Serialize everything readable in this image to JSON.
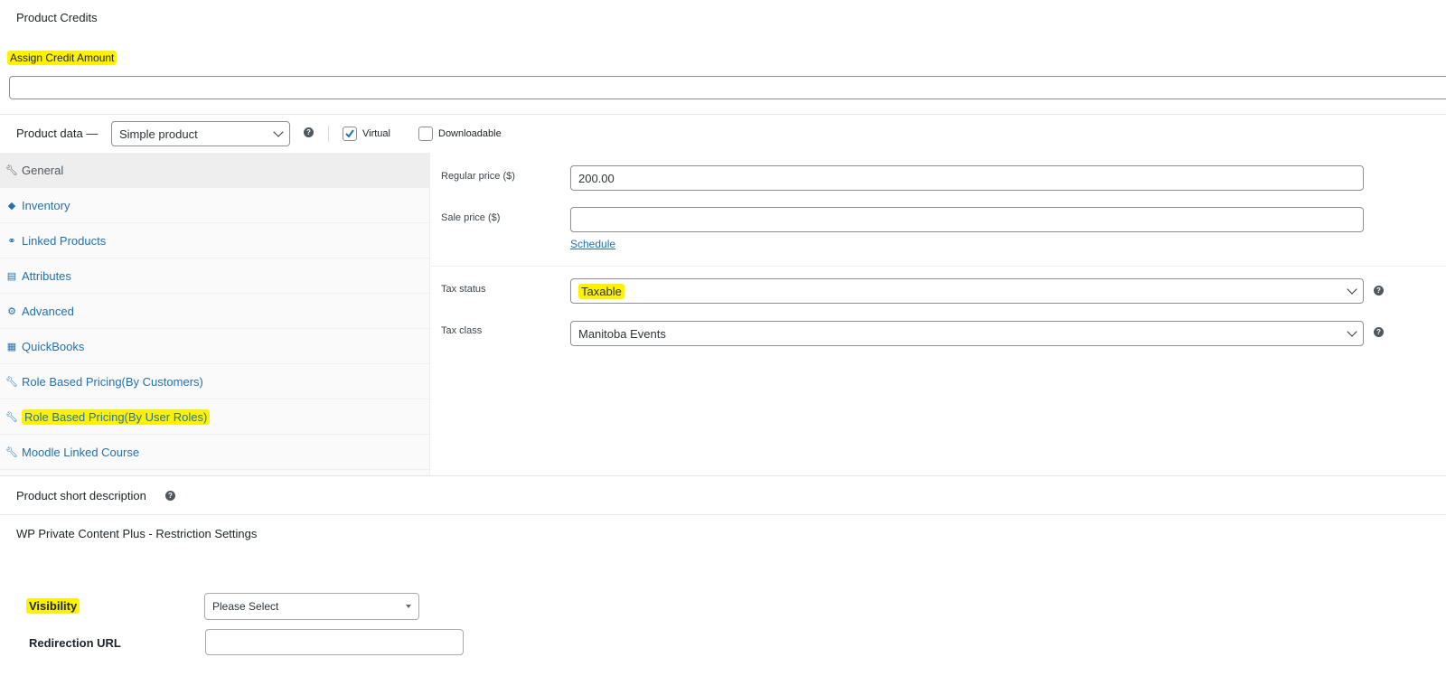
{
  "credits": {
    "section_title": "Product Credits",
    "assign_label": "Assign Credit Amount",
    "assign_value": ""
  },
  "product_data": {
    "label": "Product data —",
    "type_selected": "Simple product",
    "virtual_label": "Virtual",
    "virtual_checked": true,
    "downloadable_label": "Downloadable",
    "downloadable_checked": false
  },
  "tabs": [
    {
      "label": "General",
      "icon": "wrench-icon"
    },
    {
      "label": "Inventory",
      "icon": "tag-icon"
    },
    {
      "label": "Linked Products",
      "icon": "link-icon"
    },
    {
      "label": "Attributes",
      "icon": "list-icon"
    },
    {
      "label": "Advanced",
      "icon": "gear-icon"
    },
    {
      "label": "QuickBooks",
      "icon": "table-icon"
    },
    {
      "label": "Role Based Pricing(By Customers)",
      "icon": "wrench-icon"
    },
    {
      "label": "Role Based Pricing(By User Roles)",
      "icon": "wrench-icon"
    },
    {
      "label": "Moodle Linked Course",
      "icon": "wrench-icon"
    }
  ],
  "general": {
    "regular_price_label": "Regular price ($)",
    "regular_price_value": "200.00",
    "sale_price_label": "Sale price ($)",
    "sale_price_value": "",
    "schedule_link": "Schedule",
    "tax_status_label": "Tax status",
    "tax_status_value": "Taxable",
    "tax_class_label": "Tax class",
    "tax_class_value": "Manitoba Events"
  },
  "short_description": {
    "title": "Product short description"
  },
  "restriction": {
    "title": "WP Private Content Plus - Restriction Settings",
    "visibility_label": "Visibility",
    "visibility_value": "Please Select",
    "redirect_label": "Redirection URL",
    "redirect_value": ""
  },
  "colors": {
    "highlight": "#fff200",
    "link": "#2271b1"
  }
}
